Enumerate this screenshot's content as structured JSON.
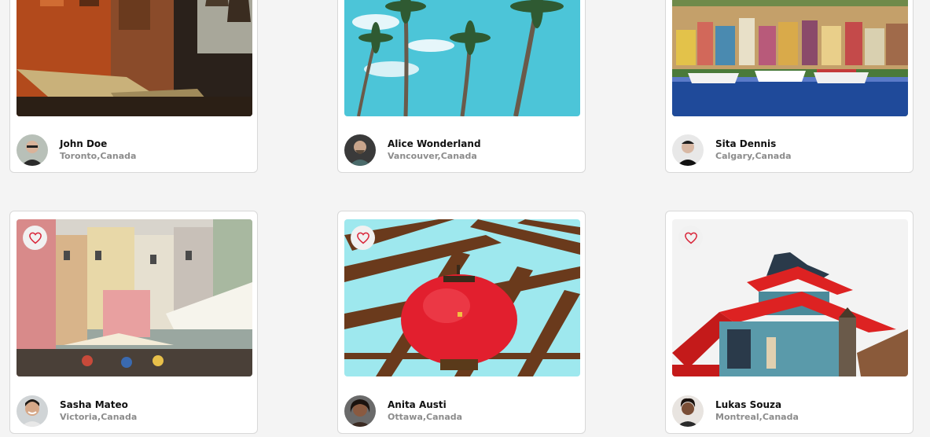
{
  "cards": [
    {
      "name": "John Doe",
      "location": "Toronto,Canada",
      "photo": "city-balconies-photo",
      "liked": false
    },
    {
      "name": "Alice Wonderland",
      "location": "Vancouver,Canada",
      "photo": "palm-trees-sky-photo",
      "liked": false
    },
    {
      "name": "Sita Dennis",
      "location": "Calgary,Canada",
      "photo": "harbor-town-photo",
      "liked": false
    },
    {
      "name": "Sasha Mateo",
      "location": "Victoria,Canada",
      "photo": "coastal-village-photo",
      "liked": true
    },
    {
      "name": "Anita Austi",
      "location": "Ottawa,Canada",
      "photo": "red-lantern-photo",
      "liked": true
    },
    {
      "name": "Lukas Souza",
      "location": "Montreal,Canada",
      "photo": "pagoda-roof-photo",
      "liked": true
    }
  ],
  "colors": {
    "heart": "#d9263a",
    "page_background": "#f4f4f4",
    "location_text": "#8c8c8c"
  },
  "icons": {
    "like": "heart-icon"
  }
}
